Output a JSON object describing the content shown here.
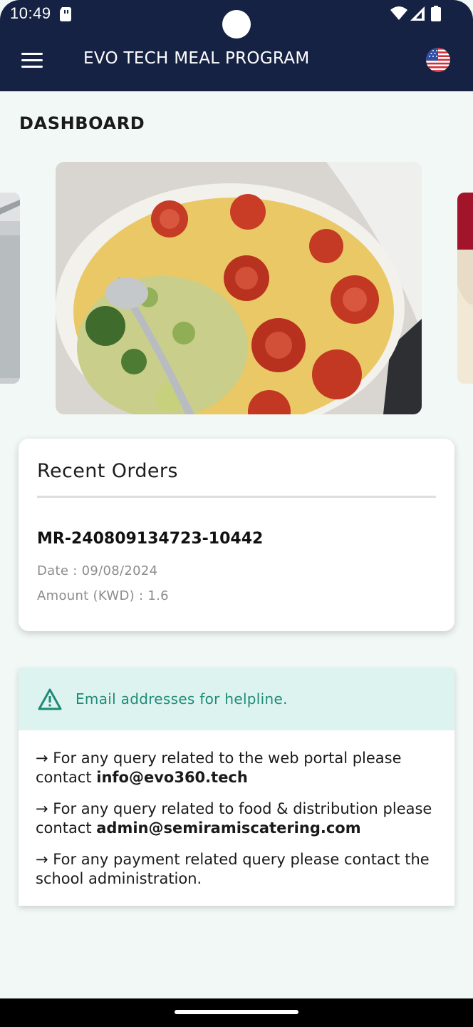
{
  "status_bar": {
    "time": "10:49"
  },
  "app_bar": {
    "title": "EVO TECH MEAL PROGRAM",
    "language_icon": "us-flag-icon"
  },
  "page": {
    "title": "DASHBOARD"
  },
  "carousel": {
    "main_image": "baked pasta with tomatoes"
  },
  "recent_orders": {
    "heading": "Recent Orders",
    "orders": [
      {
        "id": "MR-240809134723-10442",
        "date": "Date : 09/08/2024",
        "amount": "Amount (KWD) : 1.6"
      }
    ]
  },
  "helpline": {
    "banner": "Email addresses for helpline.",
    "lines": [
      {
        "prefix": "→ For any query related to the web portal please contact ",
        "email": "info@evo360.tech"
      },
      {
        "prefix": "→ For any query related to food & distribution please contact ",
        "email": "admin@semiramiscatering.com"
      },
      {
        "prefix": "→ For any payment related query please contact the school administration.",
        "email": ""
      }
    ]
  },
  "colors": {
    "app_bar": "#162244",
    "background": "#f2f8f5",
    "accent": "#1f8a78",
    "banner": "#dcf3ef"
  }
}
